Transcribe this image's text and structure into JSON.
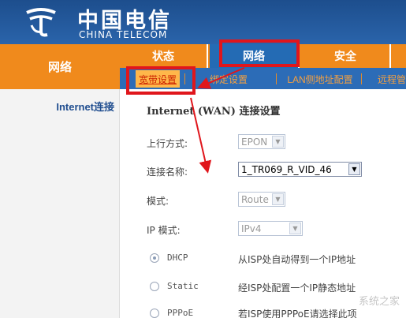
{
  "header": {
    "brand_cn": "中国电信",
    "brand_en": "CHINA TELECOM"
  },
  "section_title": "网络",
  "topnav": {
    "tabs": [
      {
        "label": "状态",
        "active": false
      },
      {
        "label": "网络",
        "active": true
      },
      {
        "label": "安全",
        "active": false
      }
    ]
  },
  "subnav": {
    "tabs": [
      {
        "label": "宽带设置",
        "active": true
      },
      {
        "label": "绑定设置",
        "active": false
      },
      {
        "label": "LAN侧地址配置",
        "active": false
      },
      {
        "label": "远程管",
        "active": false
      }
    ]
  },
  "sidebar": {
    "items": [
      {
        "label": "Internet连接"
      }
    ]
  },
  "content": {
    "title": "Internet (WAN) 连接设置",
    "fields": {
      "uplink": {
        "label": "上行方式:",
        "value": "EPON"
      },
      "connection_name": {
        "label": "连接名称:",
        "value": "1_TR069_R_VID_46"
      },
      "mode": {
        "label": "模式:",
        "value": "Route"
      },
      "ip_mode": {
        "label": "IP 模式:",
        "value": "IPv4"
      }
    },
    "radios": [
      {
        "label": "DHCP",
        "desc": "从ISP处自动得到一个IP地址",
        "checked": true
      },
      {
        "label": "Static",
        "desc": "经ISP处配置一个IP静态地址",
        "checked": false
      },
      {
        "label": "PPPoE",
        "desc": "若ISP使用PPPoE请选择此项",
        "checked": false
      }
    ]
  },
  "watermark": "系统之家",
  "colors": {
    "header_blue": "#2a64ab",
    "nav_orange": "#f08a1c",
    "subnav_blue": "#2c6cb7",
    "annotation_red": "#e0161c"
  }
}
